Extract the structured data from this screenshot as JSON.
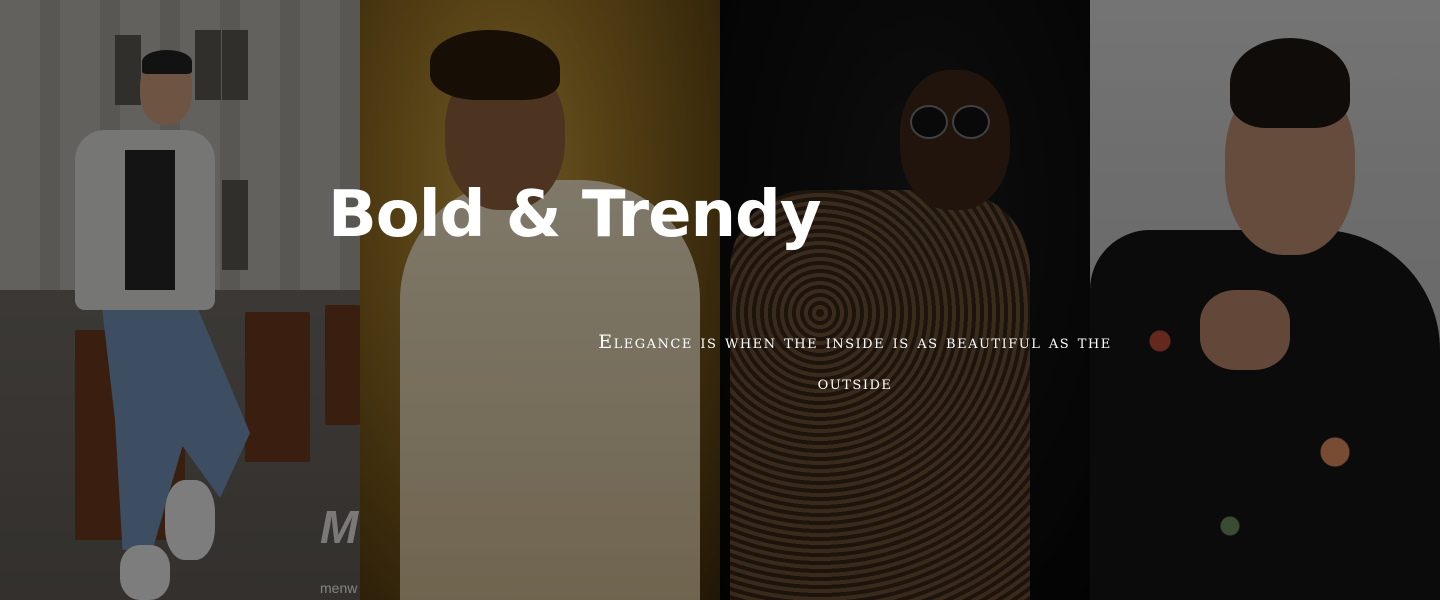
{
  "hero": {
    "title": "Bold & Trendy",
    "tagline": "Elegance is when the inside is as beautiful as the outside"
  },
  "watermark": {
    "logo_text": "M",
    "small_text": "menw"
  },
  "panels": [
    {
      "name": "street-style-man",
      "tone": "#8f8b86"
    },
    {
      "name": "cream-shirt-man",
      "tone": "#9a7526"
    },
    {
      "name": "leopard-shirt-man",
      "tone": "#0d0d0d"
    },
    {
      "name": "floral-jacket-man",
      "tone": "#c7c7c7"
    }
  ],
  "overlay_color": "#000000"
}
